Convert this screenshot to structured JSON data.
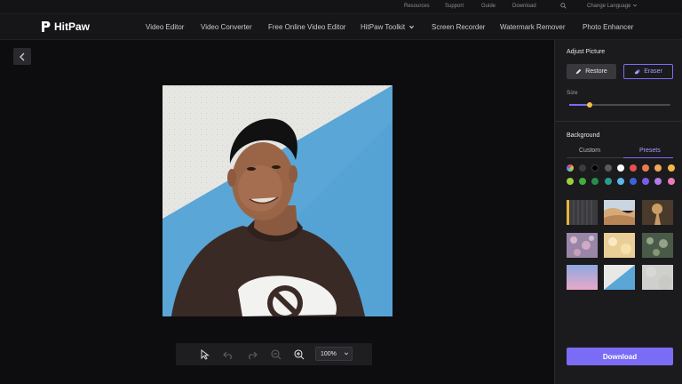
{
  "topbar": {
    "links": [
      "Resources",
      "Support",
      "Guide",
      "Download"
    ],
    "language": "Change Language"
  },
  "nav": {
    "brand": "HitPaw",
    "items": [
      "Video Editor",
      "Video Converter",
      "Free Online Video Editor",
      "HitPaw Toolkit",
      "Screen Recorder",
      "Watermark Remover",
      "Photo Enhancer"
    ]
  },
  "toolbar": {
    "zoom": "100%"
  },
  "panel": {
    "adjust_title": "Adjust Picture",
    "restore_label": "Restore",
    "eraser_label": "Eraser",
    "size_label": "Size",
    "size_value": 0.2,
    "background_title": "Background",
    "tabs": [
      "Custom",
      "Presets"
    ],
    "active_tab": "Presets",
    "download_label": "Download"
  },
  "colors": {
    "accent": "#7b6cf6",
    "swatches_row1": [
      "rainbow",
      "#3b3b3e",
      "#000000",
      "#5a5a5e",
      "#ffffff",
      "#e84f4f",
      "#f07a4a",
      "#f2a65a",
      "#f7b548"
    ],
    "swatches_row2": [
      "#9bcf3f",
      "#3fae3a",
      "#2a8a4a",
      "#2a9c8e",
      "#5bb8e8",
      "#3a63d8",
      "#7a5ce8",
      "#b47ae8",
      "#e87ab8"
    ]
  }
}
